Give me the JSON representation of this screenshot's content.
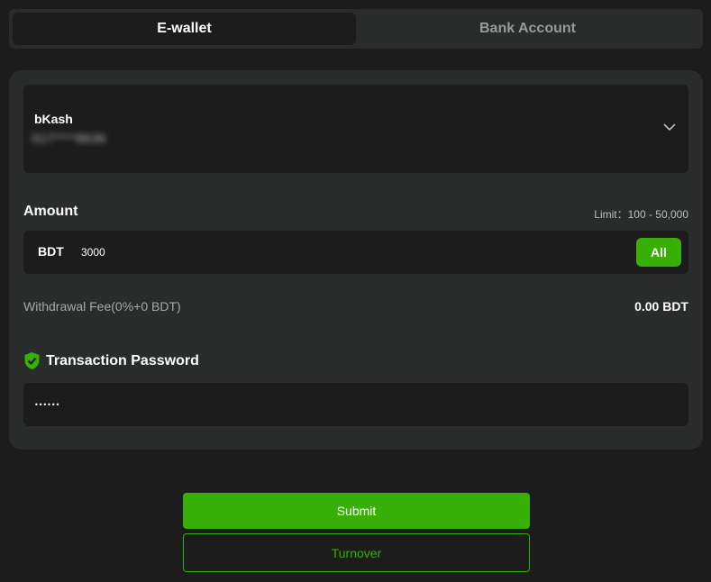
{
  "tabs": [
    {
      "label": "E-wallet",
      "active": true
    },
    {
      "label": "Bank Account",
      "active": false
    }
  ],
  "wallet": {
    "name": "bKash",
    "number": "017****8636"
  },
  "amount": {
    "label": "Amount",
    "limit": "Limit：100 - 50,000",
    "currency": "BDT",
    "value": "3000",
    "all_label": "All"
  },
  "fee": {
    "label": "Withdrawal Fee(0%+0 BDT)",
    "value": "0.00 BDT"
  },
  "password": {
    "label": "Transaction Password",
    "value": "••••••"
  },
  "actions": {
    "submit_label": "Submit",
    "turnover_label": "Turnover"
  },
  "colors": {
    "accent": "#37af07",
    "background": "#1c1c1c",
    "card": "#2a2b2b"
  },
  "icons": {
    "wallet_dropdown": "chevron-down-icon",
    "password": "shield-check-icon"
  }
}
